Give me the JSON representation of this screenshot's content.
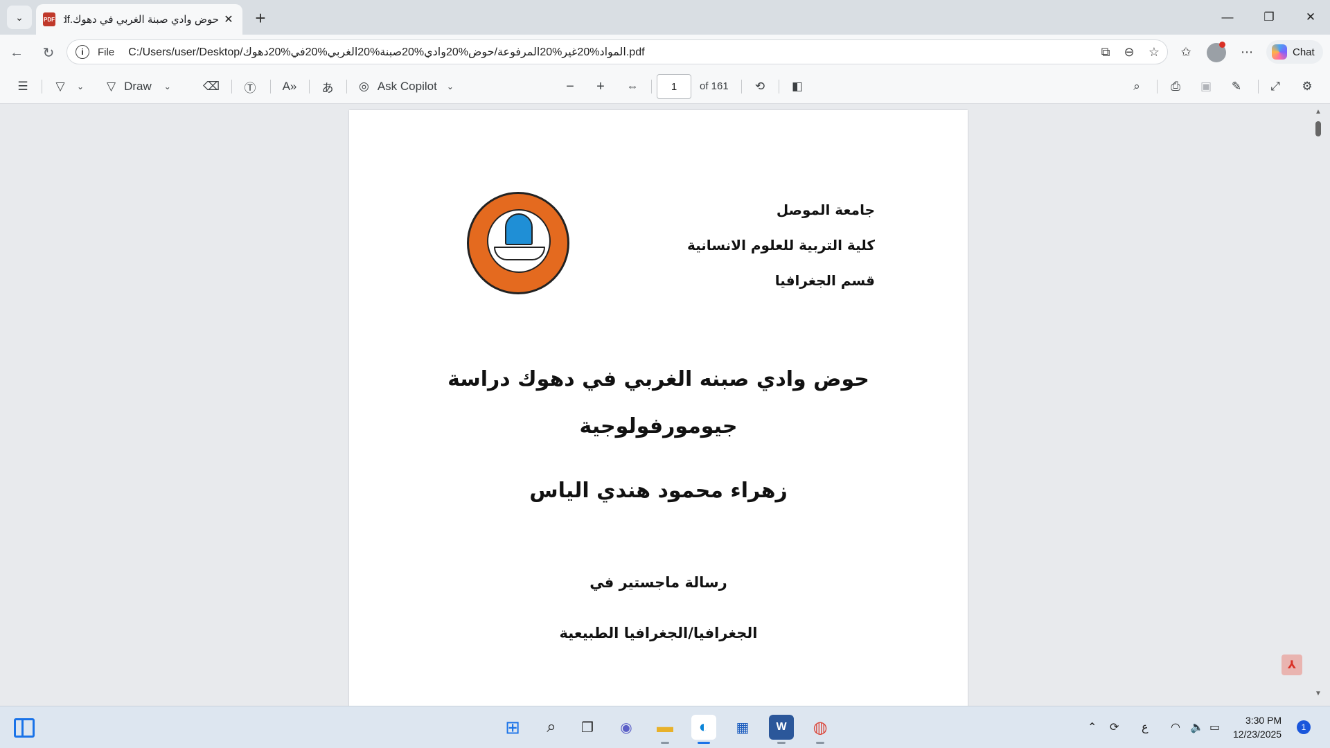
{
  "browser": {
    "tab": {
      "title": "حوض وادي صبنة الغربي في دهوك.pdf",
      "file_badge": "PDF"
    },
    "address": {
      "scheme_label": "File",
      "url": "C:/Users/user/Desktop/المواد%20غير%20المرفوعة/حوض%20وادي%20صبنة%20الغربي%20في%20دهوك.pdf"
    },
    "chat_label": "Chat"
  },
  "pdf_toolbar": {
    "draw_label": "Draw",
    "ask_copilot_label": "Ask Copilot",
    "current_page": "1",
    "page_count_label": "of 161"
  },
  "document": {
    "university": "جامعة الموصل",
    "college": "كلية التربية للعلوم الانسانية",
    "department": "قسم الجغرافيا",
    "title_line1": "حوض وادي صبنه الغربي في دهوك دراسة",
    "title_line2": "جيومورفولوجية",
    "author": "زهراء محمود هندي الياس",
    "thesis_line1": "رسالة ماجستير في",
    "thesis_line2": "الجغرافيا/الجغرافيا الطبيعية"
  },
  "taskbar": {
    "ime_indicator": "ع",
    "time": "3:30 PM",
    "date": "12/23/2025",
    "notification_count": "1"
  }
}
